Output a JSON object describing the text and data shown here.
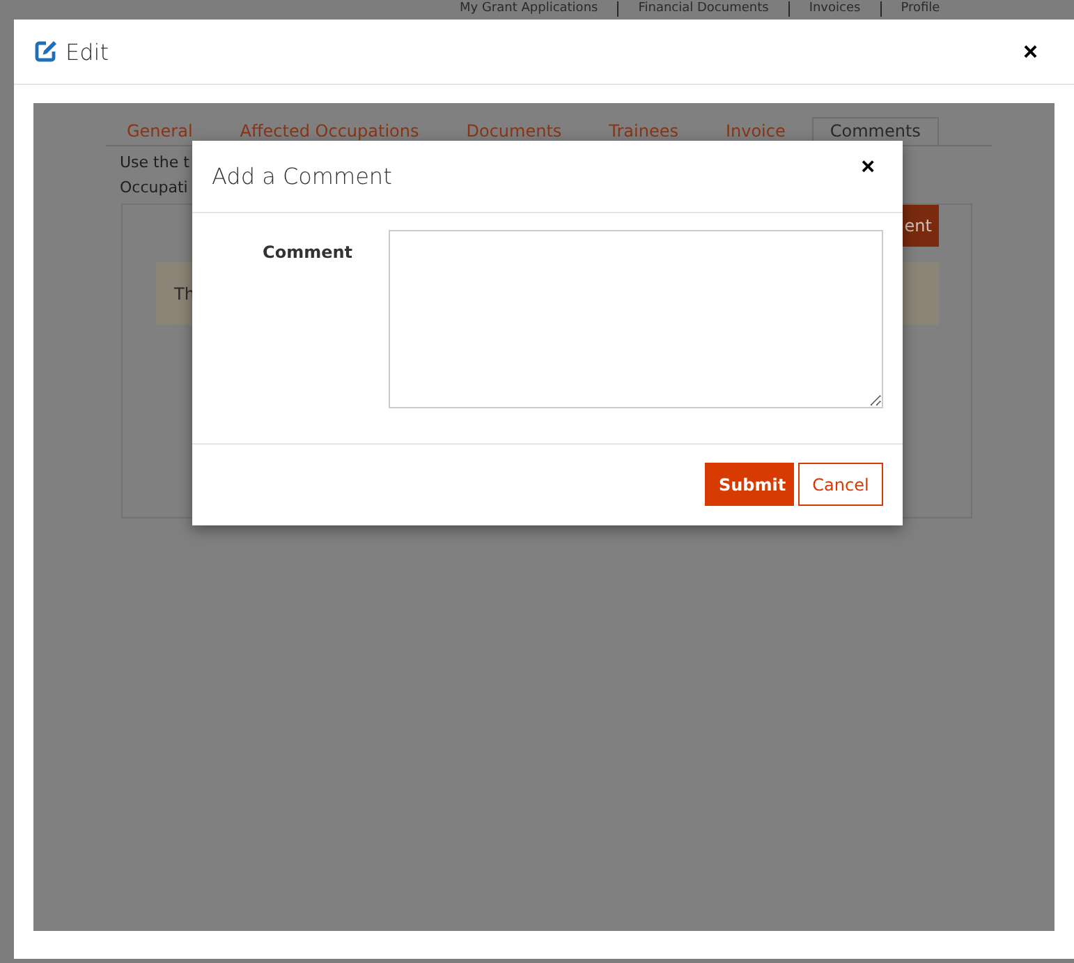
{
  "top_nav": [
    {
      "label": "My Grant Applications"
    },
    {
      "label": "Financial Documents"
    },
    {
      "label": "Invoices"
    },
    {
      "label": "Profile"
    }
  ],
  "dialog": {
    "title": "Edit",
    "close": "×"
  },
  "tabs": [
    {
      "label": "General",
      "selected": false
    },
    {
      "label": "Affected Occupations",
      "selected": false
    },
    {
      "label": "Documents",
      "selected": false
    },
    {
      "label": "Trainees",
      "selected": false
    },
    {
      "label": "Invoice",
      "selected": false
    },
    {
      "label": "Comments",
      "selected": true
    }
  ],
  "intro_lines": [
    "Use the t",
    "Occupati"
  ],
  "action_button": "ent",
  "notice": "Th",
  "modal": {
    "title": "Add a Comment",
    "close": "×",
    "field_label": "Comment",
    "buttons": [
      {
        "label": "Submit",
        "kind": "primary"
      },
      {
        "label": "Cancel",
        "kind": "secondary"
      }
    ]
  }
}
